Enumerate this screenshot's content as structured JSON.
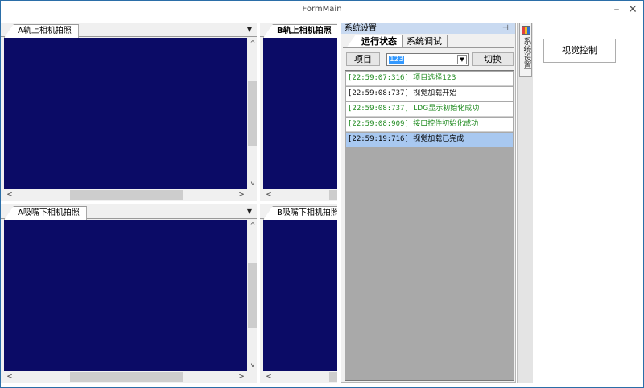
{
  "window": {
    "title": "FormMain",
    "minimize_glyph": "–",
    "close_glyph": "✕"
  },
  "cameras": {
    "a_rail": {
      "tab_label": "A轨上相机拍照"
    },
    "b_rail": {
      "tab_label": "B轨上相机拍照"
    },
    "a_nozzle": {
      "tab_label": "A吸嘴下相机拍照"
    },
    "b_nozzle": {
      "tab_label": "B吸嘴下相机拍照"
    }
  },
  "system_panel": {
    "title": "系统设置",
    "pin_glyph": "⊣",
    "tabs": [
      {
        "label": "运行状态",
        "active": true
      },
      {
        "label": "系统调试",
        "active": false
      }
    ],
    "item_button_label": "项目",
    "project_combo_value": "123",
    "switch_button_label": "切换",
    "log": [
      {
        "time": "[22:59:07:316]",
        "message": "项目选择123",
        "color": "green",
        "selected": false
      },
      {
        "time": "[22:59:08:737]",
        "message": "视觉加载开始",
        "color": "black",
        "selected": false
      },
      {
        "time": "[22:59:08:737]",
        "message": "LDG显示初始化成功",
        "color": "green",
        "selected": false
      },
      {
        "time": "[22:59:08:909]",
        "message": "接口控件初始化成功",
        "color": "green",
        "selected": false
      },
      {
        "time": "[22:59:19:716]",
        "message": "视觉加载已完成",
        "color": "black",
        "selected": true
      }
    ]
  },
  "side_tab": {
    "label": "系统设置",
    "icon": "color-bars-icon"
  },
  "vision_button_label": "视觉控制",
  "colors": {
    "camera_view": "#0b0b66",
    "panel_header": "#c9daf1",
    "log_green": "#1f8a1f",
    "selection": "#a8c8f0"
  }
}
